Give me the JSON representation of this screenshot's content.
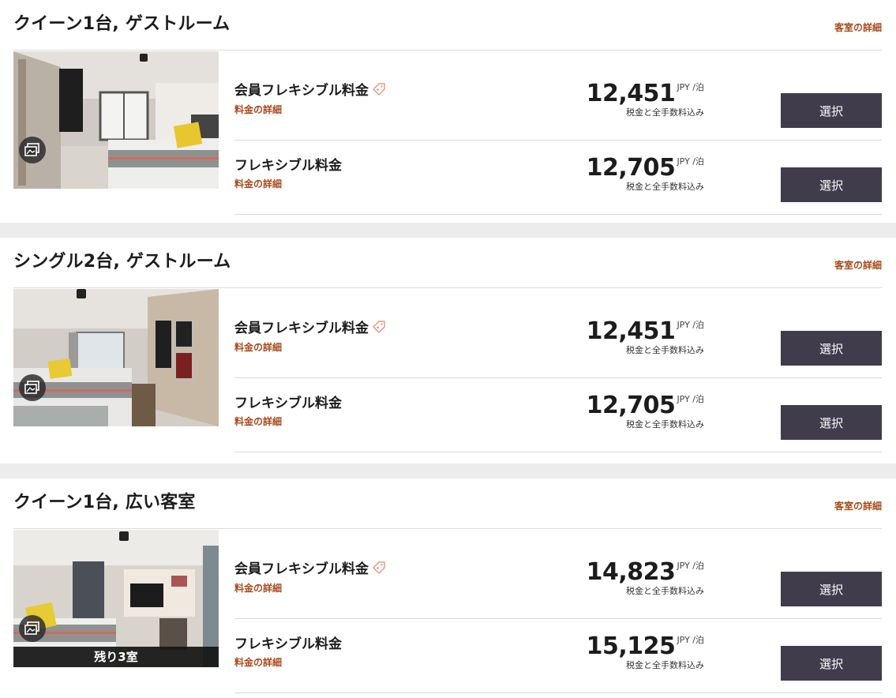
{
  "rooms": [
    {
      "title": "クイーン1台, ゲストルーム",
      "details_link": "客室の詳細",
      "photo_style": "queen",
      "remaining": null,
      "rates": [
        {
          "name": "会員フレキシブル料金",
          "member_tag": true,
          "detail_link": "料金の詳細",
          "price": "12,451",
          "unit": "JPY /泊",
          "note": "税金と全手数料込み",
          "button": "選択"
        },
        {
          "name": "フレキシブル料金",
          "member_tag": false,
          "detail_link": "料金の詳細",
          "price": "12,705",
          "unit": "JPY /泊",
          "note": "税金と全手数料込み",
          "button": "選択"
        }
      ]
    },
    {
      "title": "シングル2台, ゲストルーム",
      "details_link": "客室の詳細",
      "photo_style": "twin",
      "remaining": null,
      "rates": [
        {
          "name": "会員フレキシブル料金",
          "member_tag": true,
          "detail_link": "料金の詳細",
          "price": "12,451",
          "unit": "JPY /泊",
          "note": "税金と全手数料込み",
          "button": "選択"
        },
        {
          "name": "フレキシブル料金",
          "member_tag": false,
          "detail_link": "料金の詳細",
          "price": "12,705",
          "unit": "JPY /泊",
          "note": "税金と全手数料込み",
          "button": "選択"
        }
      ]
    },
    {
      "title": "クイーン1台, 広い客室",
      "details_link": "客室の詳細",
      "photo_style": "large",
      "remaining": "残り3室",
      "rates": [
        {
          "name": "会員フレキシブル料金",
          "member_tag": true,
          "detail_link": "料金の詳細",
          "price": "14,823",
          "unit": "JPY /泊",
          "note": "税金と全手数料込み",
          "button": "選択"
        },
        {
          "name": "フレキシブル料金",
          "member_tag": false,
          "detail_link": "料金の詳細",
          "price": "15,125",
          "unit": "JPY /泊",
          "note": "税金と全手数料込み",
          "button": "選択"
        }
      ]
    }
  ],
  "icons": {
    "gallery": "gallery-icon",
    "member_tag": "price-tag-icon"
  },
  "colors": {
    "accent_link": "#a8491b",
    "button_bg": "#403c4b",
    "button_text": "#ffffff",
    "page_bg": "#ececec"
  }
}
